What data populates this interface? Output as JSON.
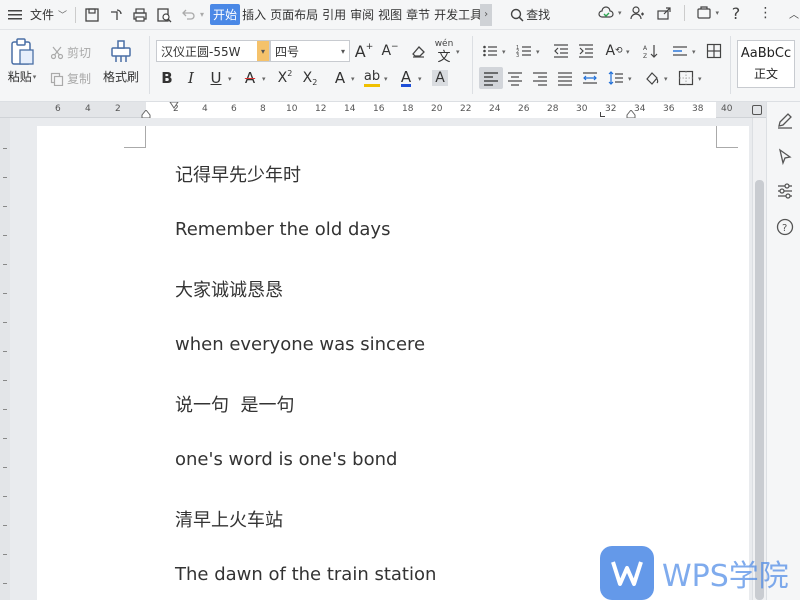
{
  "menubar": {
    "file_label": "文件",
    "tabs": [
      {
        "label": "开始",
        "active": true
      },
      {
        "label": "插入"
      },
      {
        "label": "页面布局"
      },
      {
        "label": "引用"
      },
      {
        "label": "审阅"
      },
      {
        "label": "视图"
      },
      {
        "label": "章节"
      },
      {
        "label": "开发工具"
      }
    ],
    "search_label": "查找"
  },
  "ribbon": {
    "paste_label": "粘贴",
    "cut_label": "剪切",
    "copy_label": "复制",
    "format_painter_label": "格式刷",
    "font_name": "汉仪正圆-55W",
    "font_size": "四号",
    "style_preview": "AaBbCc",
    "style_name": "正文"
  },
  "ruler": {
    "ticks": [
      "6",
      "4",
      "2",
      "2",
      "4",
      "6",
      "8",
      "10",
      "12",
      "14",
      "16",
      "18",
      "20",
      "22",
      "24",
      "26",
      "28",
      "30",
      "32",
      "34",
      "36",
      "38",
      "40"
    ]
  },
  "document": {
    "lines": [
      "记得早先少年时",
      "Remember the old days",
      "大家诚诚恳恳",
      "when everyone was sincere",
      "说一句  是一句",
      "one's word is one's bond",
      "清早上火车站",
      "The dawn of the train station"
    ]
  },
  "watermark": {
    "text": "WPS学院"
  },
  "colors": {
    "accent": "#4a88e6",
    "font_color_underline": "#1f4fd8",
    "highlight_underline": "#f0c000"
  }
}
